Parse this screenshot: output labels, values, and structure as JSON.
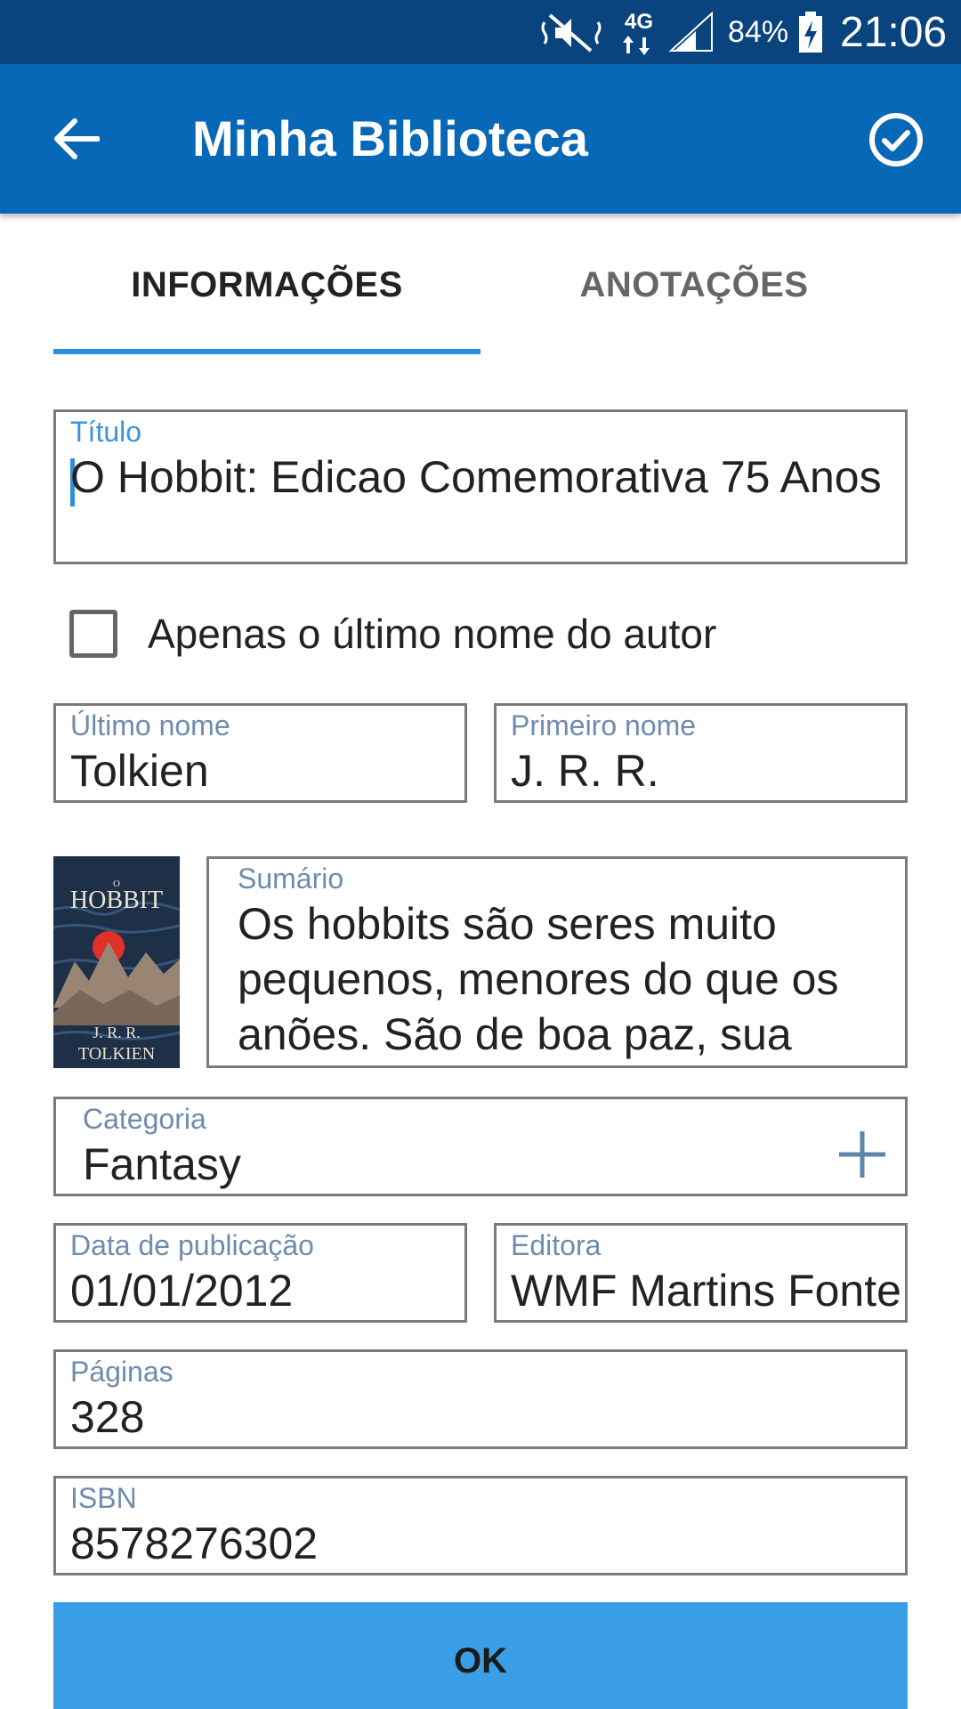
{
  "status_bar": {
    "battery_percent": "84%",
    "time": "21:06",
    "network_label": "4G",
    "icons": [
      "mute-vibrate-icon",
      "network-4g-icon",
      "signal-icon",
      "battery-charging-icon"
    ]
  },
  "app_bar": {
    "title": "Minha Biblioteca",
    "back_icon": "arrow-left-icon",
    "confirm_icon": "check-circle-icon",
    "color": "#0768b8"
  },
  "tabs": [
    {
      "label": "INFORMAÇÕES",
      "selected": true
    },
    {
      "label": "ANOTAÇÕES",
      "selected": false
    }
  ],
  "form": {
    "title": {
      "label": "Título",
      "value": "O Hobbit: Edicao Comemorativa 75 Anos"
    },
    "last_name_only": {
      "label": "Apenas o último nome do autor",
      "checked": false
    },
    "last_name": {
      "label": "Último nome",
      "value": "Tolkien"
    },
    "first_name": {
      "label": "Primeiro nome",
      "value": "J. R. R."
    },
    "cover": {
      "small_text": "O",
      "title_text": "HOBBIT",
      "author_line1": "J. R. R.",
      "author_line2": "TOLKIEN"
    },
    "summary": {
      "label": "Sumário",
      "value": "Os hobbits são seres muito pequenos, menores do que os anões. São de boa paz, sua"
    },
    "category": {
      "label": "Categoria",
      "value": "Fantasy",
      "add_icon": "plus-icon"
    },
    "publication_date": {
      "label": "Data de publicação",
      "value": "01/01/2012"
    },
    "publisher": {
      "label": "Editora",
      "value": "WMF Martins Fontes"
    },
    "pages": {
      "label": "Páginas",
      "value": "328"
    },
    "isbn": {
      "label": "ISBN",
      "value": "8578276302"
    }
  },
  "ok_button": {
    "label": "OK",
    "color": "#3a9ee6"
  }
}
